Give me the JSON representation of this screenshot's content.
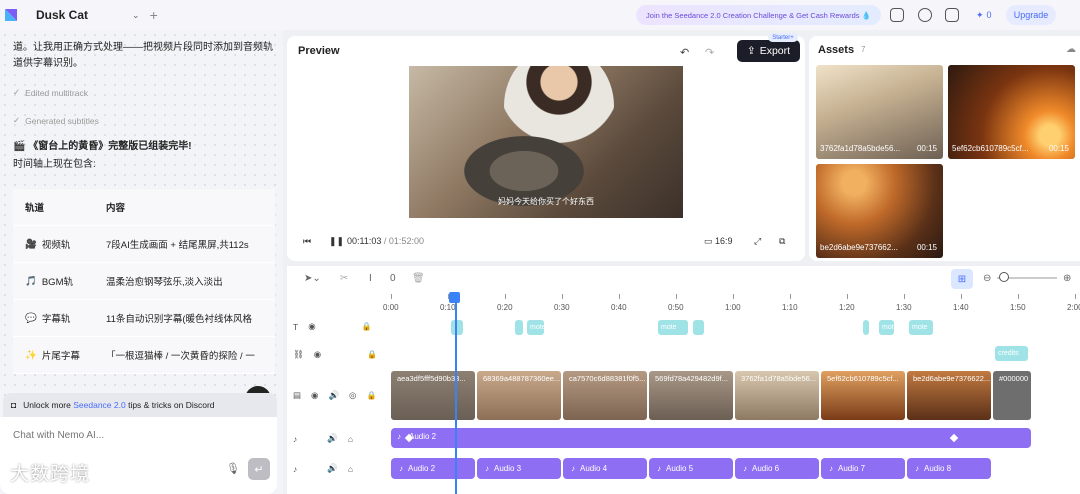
{
  "topbar": {
    "project_title": "Dusk Cat",
    "banner_text": "Join the Seedance 2.0 Creation Challenge & Get Cash Rewards 💧",
    "credits": "0",
    "upgrade_label": "Upgrade"
  },
  "chat": {
    "intro_text": "道。让我用正确方式处理——把视频片段同时添加到音频轨道供字幕识别。",
    "steps": [
      "Edited multitrack",
      "Generated subtitles"
    ],
    "done_title": "🎬 《窗台上的黄昏》完整版已组装完毕!",
    "timeline_intro": "时间轴上现在包含:",
    "table_headers": [
      "轨道",
      "内容"
    ],
    "table_rows": [
      {
        "icon": "🎥",
        "track": "视频轨",
        "content": "7段AI生成画面 + 结尾黑屏,共112s"
      },
      {
        "icon": "🎵",
        "track": "BGM轨",
        "content": "温柔治愈钢琴弦乐,淡入淡出"
      },
      {
        "icon": "💬",
        "track": "字幕轨",
        "content": "11条自动识别字幕(暖色衬线体风格"
      },
      {
        "icon": "✨",
        "track": "片尾字幕",
        "content": "「一根逗猫棒 / 一次黄昏的探险 / 一"
      }
    ],
    "discord_prefix": "Unlock more",
    "discord_highlight": "Seedance 2.0",
    "discord_suffix": "tips & tricks on Discord",
    "input_placeholder": "Chat with Nemo AI...",
    "watermark": "大数跨境"
  },
  "preview": {
    "title": "Preview",
    "export_label": "Export",
    "starter_badge": "Starter+",
    "subtitle": "妈妈今天给你买了个好东西",
    "current_time": "00:11:03",
    "total_time": "01:52:00",
    "aspect_ratio": "16:9"
  },
  "assets": {
    "title": "Assets",
    "count": "7",
    "items": [
      {
        "name": "3762fa1d78a5bde56...",
        "duration": "00:15"
      },
      {
        "name": "5ef62cb610789c5cf...",
        "duration": "00:15"
      },
      {
        "name": "be2d6abe9e737662...",
        "duration": "00:15"
      }
    ]
  },
  "timeline": {
    "tool_value": "0",
    "ruler": [
      "0:00",
      "0:10",
      "0:20",
      "0:30",
      "0:40",
      "0:50",
      "1:00",
      "1:10",
      "1:20",
      "1:30",
      "1:40",
      "1:50",
      "2:00"
    ],
    "text_clips": [
      "mote",
      "mote",
      "mote",
      "mote"
    ],
    "credit_clip": "credits",
    "video_clips": [
      "aea3df5fff5d90b38...",
      "68369a488787360ee...",
      "ca7570c6d88381f0f5...",
      "569fd78a429482d9f...",
      "3762fa1d78a5bde56...",
      "5ef62cb610789c5cf...",
      "be2d6abe9e7376622...",
      "#000000"
    ],
    "bgm_label": "Audio 2",
    "audio_clips": [
      "Audio 2",
      "Audio 3",
      "Audio 4",
      "Audio 5",
      "Audio 6",
      "Audio 7",
      "Audio 8"
    ]
  },
  "colors": {
    "accent": "#4a6cf7",
    "audio": "#8e6ef2",
    "text_clip": "#9fe3e6",
    "playhead": "#3b82f6",
    "export_bg": "#1b1e28"
  }
}
